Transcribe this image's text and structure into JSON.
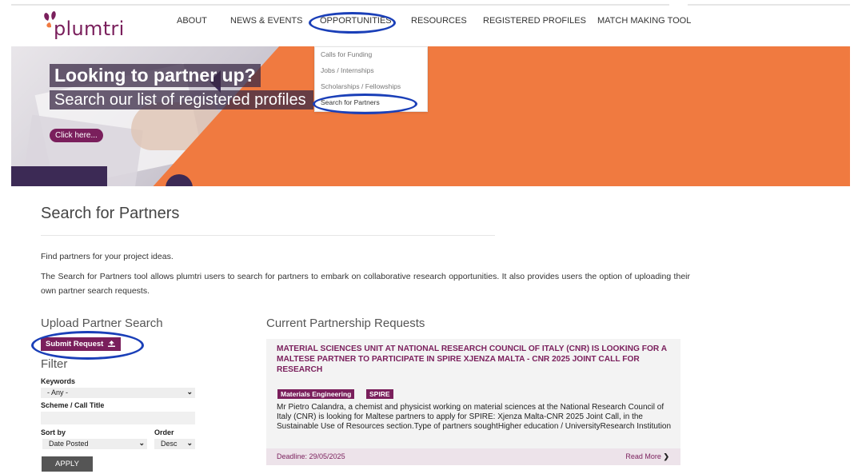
{
  "brand": {
    "name": "plumtri",
    "colors": {
      "primary": "#7a1f5c",
      "accent": "#f07a40",
      "highlight": "#1a3fb8"
    }
  },
  "nav": {
    "items": [
      {
        "label": "ABOUT"
      },
      {
        "label": "NEWS & EVENTS"
      },
      {
        "label": "OPPORTUNITIES"
      },
      {
        "label": "RESOURCES"
      },
      {
        "label": "REGISTERED PROFILES"
      },
      {
        "label": "MATCH MAKING TOOL"
      }
    ],
    "dropdown": [
      {
        "label": "Calls for Funding"
      },
      {
        "label": "Jobs / Internships"
      },
      {
        "label": "Scholarships / Fellowships"
      },
      {
        "label": "Search for Partners"
      }
    ]
  },
  "hero": {
    "title": "Looking to partner up?",
    "subtitle": "Search our list of registered profiles",
    "button": "Click here..."
  },
  "page": {
    "title": "Search for Partners",
    "intro": "Find partners for your project ideas.",
    "description": "The Search for Partners tool allows plumtri users to search for partners to embark on collaborative research opportunities. It also provides users the option of uploading their own partner search requests."
  },
  "sidebar": {
    "upload_heading": "Upload Partner Search",
    "submit_label": "Submit Request",
    "filter_heading": "Filter",
    "keywords_label": "Keywords",
    "keywords_value": "- Any -",
    "scheme_label": "Scheme / Call Title",
    "sortby_label": "Sort by",
    "sortby_value": "Date Posted",
    "order_label": "Order",
    "order_value": "Desc",
    "apply_label": "APPLY"
  },
  "requests": {
    "heading": "Current Partnership Requests",
    "items": [
      {
        "title": "MATERIAL SCIENCES UNIT AT NATIONAL RESEARCH COUNCIL OF ITALY (CNR) IS LOOKING FOR A MALTESE PARTNER TO PARTICIPATE IN SPIRE XJENZA MALTA - CNR 2025 JOINT CALL FOR RESEARCH",
        "tags": [
          "Materials Engineering",
          "SPIRE"
        ],
        "text": "Mr Pietro Calandra, a chemist and physicist working on material sciences at the National Research Council of Italy (CNR) is looking for Maltese partners to apply for SPIRE: Xjenza Malta-CNR 2025 Joint Call, in the Sustainable Use of Resources section.Type of partners soughtHigher education / UniversityResearch Institution",
        "deadline": "Deadline: 29/05/2025",
        "read_more": "Read More"
      }
    ]
  }
}
